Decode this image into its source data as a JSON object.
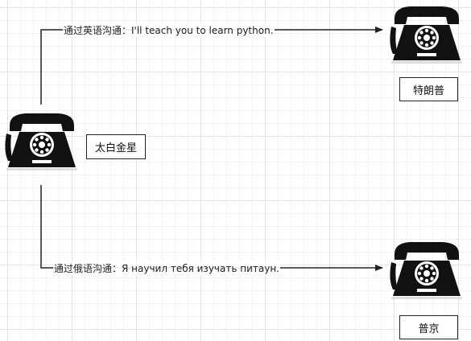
{
  "nodes": {
    "source": {
      "label": "太白金星",
      "icon": "telephone-icon"
    },
    "trump": {
      "label": "特朗普",
      "icon": "telephone-icon"
    },
    "putin": {
      "label": "普京",
      "icon": "telephone-icon"
    }
  },
  "edges": {
    "english": {
      "label": "通过英语沟通：I'll teach you to learn python."
    },
    "russian": {
      "label": "通过俄语沟通：Я научил тебя изучать питаун."
    }
  },
  "colors": {
    "line": "#222222",
    "phone": "#111111",
    "box_border": "#222222"
  }
}
